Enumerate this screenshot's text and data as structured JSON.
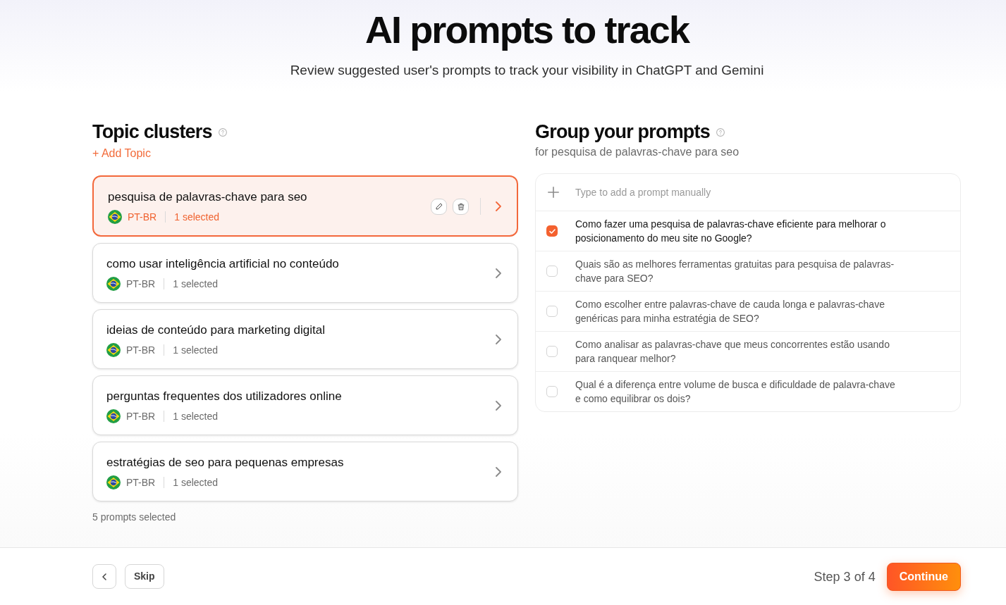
{
  "header": {
    "title": "AI prompts to track",
    "subtitle": "Review suggested user's prompts to track your visibility in ChatGPT and Gemini"
  },
  "topics_panel": {
    "title": "Topic clusters",
    "add_label": "+ Add Topic",
    "topics": [
      {
        "name": "pesquisa de palavras-chave para seo",
        "locale": "PT-BR",
        "count": "1 selected",
        "selected": true
      },
      {
        "name": "como usar inteligência artificial no conteúdo",
        "locale": "PT-BR",
        "count": "1 selected",
        "selected": false
      },
      {
        "name": "ideias de conteúdo para marketing digital",
        "locale": "PT-BR",
        "count": "1 selected",
        "selected": false
      },
      {
        "name": "perguntas frequentes dos utilizadores online",
        "locale": "PT-BR",
        "count": "1 selected",
        "selected": false
      },
      {
        "name": "estratégias de seo para pequenas empresas",
        "locale": "PT-BR",
        "count": "1 selected",
        "selected": false
      }
    ],
    "summary": "5 prompts selected"
  },
  "prompts_panel": {
    "title": "Group your prompts",
    "subtitle": "for pesquisa de palavras-chave para seo",
    "input": {
      "placeholder": "Type to add a prompt manually"
    },
    "prompts": [
      {
        "text": "Como fazer uma pesquisa de palavras-chave eficiente para melhorar o posicionamento do meu site no Google?",
        "checked": true
      },
      {
        "text": "Quais são as melhores ferramentas gratuitas para pesquisa de palavras-chave para SEO?",
        "checked": false
      },
      {
        "text": "Como escolher entre palavras-chave de cauda longa e palavras-chave genéricas para minha estratégia de SEO?",
        "checked": false
      },
      {
        "text": "Como analisar as palavras-chave que meus concorrentes estão usando para ranquear melhor?",
        "checked": false
      },
      {
        "text": "Qual é a diferença entre volume de busca e dificuldade de palavra-chave e como equilibrar os dois?",
        "checked": false
      }
    ]
  },
  "footer": {
    "skip_label": "Skip",
    "step": "Step 3 of 4",
    "continue_label": "Continue"
  }
}
